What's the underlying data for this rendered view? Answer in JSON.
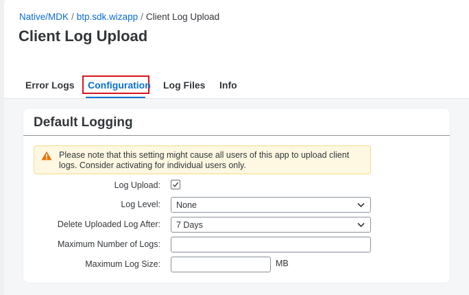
{
  "breadcrumb": {
    "items": [
      "Native/MDK",
      "btp.sdk.wizapp"
    ],
    "separator": "/",
    "current": "Client Log Upload"
  },
  "page": {
    "title": "Client Log Upload"
  },
  "tabs": [
    {
      "label": "Error Logs",
      "active": false
    },
    {
      "label": "Configuration",
      "active": true
    },
    {
      "label": "Log Files",
      "active": false
    },
    {
      "label": "Info",
      "active": false
    }
  ],
  "card": {
    "title": "Default Logging",
    "warning": "Please note that this setting might cause all users of this app to upload client logs. Consider activating for individual users only."
  },
  "form": {
    "log_upload": {
      "label": "Log Upload:",
      "checked": true
    },
    "log_level": {
      "label": "Log Level:",
      "value": "None"
    },
    "delete_after": {
      "label": "Delete Uploaded Log After:",
      "value": "7 Days"
    },
    "max_logs": {
      "label": "Maximum Number of Logs:",
      "value": ""
    },
    "max_size": {
      "label": "Maximum Log Size:",
      "value": "",
      "unit": "MB"
    }
  },
  "colors": {
    "accent": "#0a6ed1",
    "highlight_border": "#d6161a",
    "warning_bg": "#fef7e1",
    "warning_icon": "#e9730c"
  },
  "icons": {
    "warning": "warning-triangle-icon",
    "checkbox": "checkmark-icon",
    "dropdown": "chevron-down-icon"
  }
}
